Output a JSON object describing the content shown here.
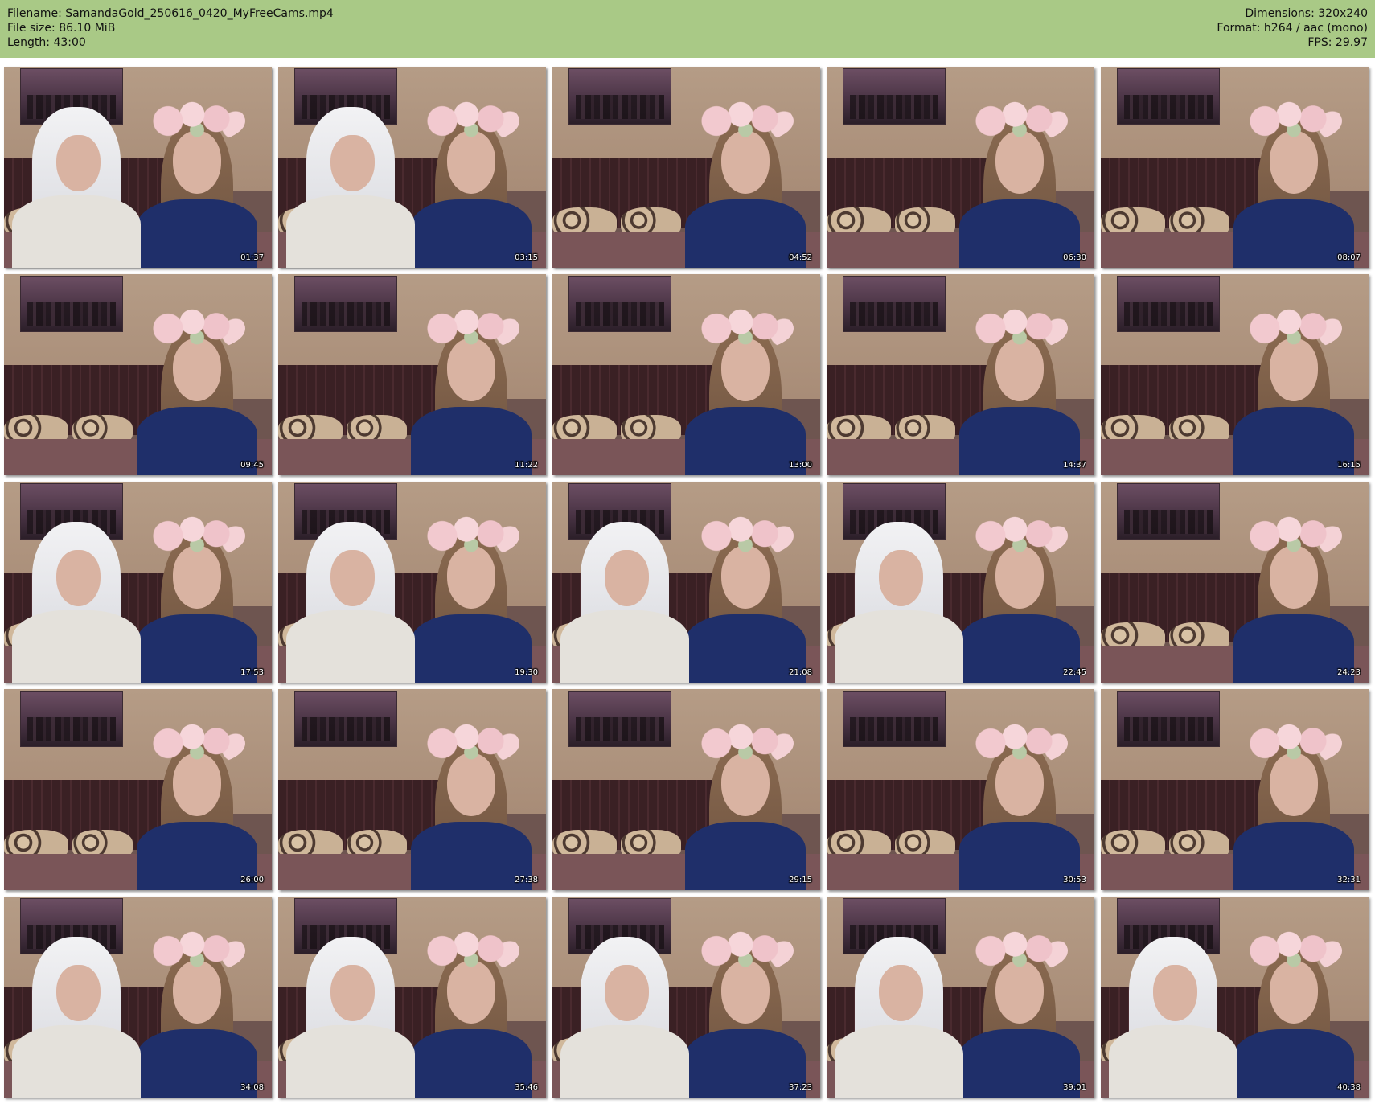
{
  "header": {
    "filename": "Filename: SamandaGold_250616_0420_MyFreeCams.mp4",
    "filesize": "File size: 86.10 MiB",
    "length": "Length: 43:00",
    "dimensions": "Dimensions: 320x240",
    "format": "Format: h264 / aac (mono)",
    "fps": "FPS: 29.97"
  },
  "colors": {
    "header_bg": "#a9c986",
    "page_bg": "#ffffff"
  },
  "thumbnails": [
    {
      "time": "01:37",
      "wig": true
    },
    {
      "time": "03:15",
      "wig": true
    },
    {
      "time": "04:52",
      "wig": false
    },
    {
      "time": "06:30",
      "wig": false
    },
    {
      "time": "08:07",
      "wig": false
    },
    {
      "time": "09:45",
      "wig": false
    },
    {
      "time": "11:22",
      "wig": false
    },
    {
      "time": "13:00",
      "wig": false
    },
    {
      "time": "14:37",
      "wig": false
    },
    {
      "time": "16:15",
      "wig": false
    },
    {
      "time": "17:53",
      "wig": true
    },
    {
      "time": "19:30",
      "wig": true
    },
    {
      "time": "21:08",
      "wig": true
    },
    {
      "time": "22:45",
      "wig": true
    },
    {
      "time": "24:23",
      "wig": false
    },
    {
      "time": "26:00",
      "wig": false
    },
    {
      "time": "27:38",
      "wig": false
    },
    {
      "time": "29:15",
      "wig": false
    },
    {
      "time": "30:53",
      "wig": false
    },
    {
      "time": "32:31",
      "wig": false
    },
    {
      "time": "34:08",
      "wig": true
    },
    {
      "time": "35:46",
      "wig": true
    },
    {
      "time": "37:23",
      "wig": true
    },
    {
      "time": "39:01",
      "wig": true
    },
    {
      "time": "40:38",
      "wig": true
    }
  ]
}
